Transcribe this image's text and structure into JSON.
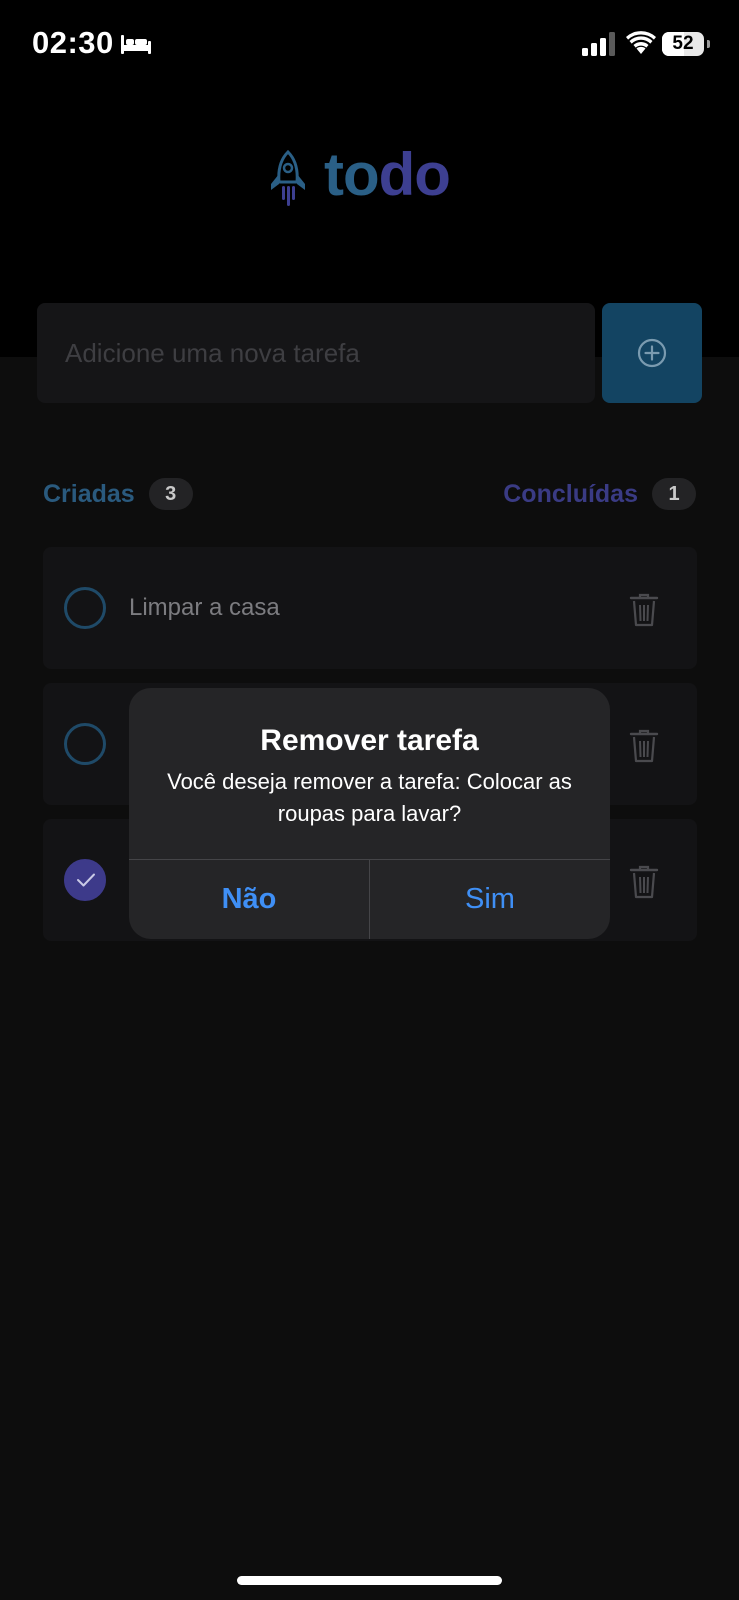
{
  "status_bar": {
    "time": "02:30",
    "sleep_icon": "bed-icon",
    "battery": "52",
    "battery_level": 0.52
  },
  "logo": {
    "icon": "rocket-icon",
    "text_part1": "to",
    "text_part2": "do"
  },
  "new_task": {
    "placeholder": "Adicione uma nova tarefa",
    "value": "",
    "add_icon": "plus-circle-icon"
  },
  "counters": {
    "created_label": "Criadas",
    "created_count": "3",
    "done_label": "Concluídas",
    "done_count": "1"
  },
  "tasks": [
    {
      "text": "Limpar a casa",
      "completed": false
    },
    {
      "text": "",
      "completed": false
    },
    {
      "text": "",
      "completed": true
    }
  ],
  "dialog": {
    "title": "Remover tarefa",
    "message": "Você deseja remover a tarefa: Colocar as roupas para lavar?",
    "cancel_label": "Não",
    "confirm_label": "Sim"
  },
  "colors": {
    "background": "#0d0d0d",
    "header_bg": "#000000",
    "accent_blue": "#2a5f86",
    "accent_purple": "#3d3f91",
    "dialog_button": "#3f8ff5"
  }
}
